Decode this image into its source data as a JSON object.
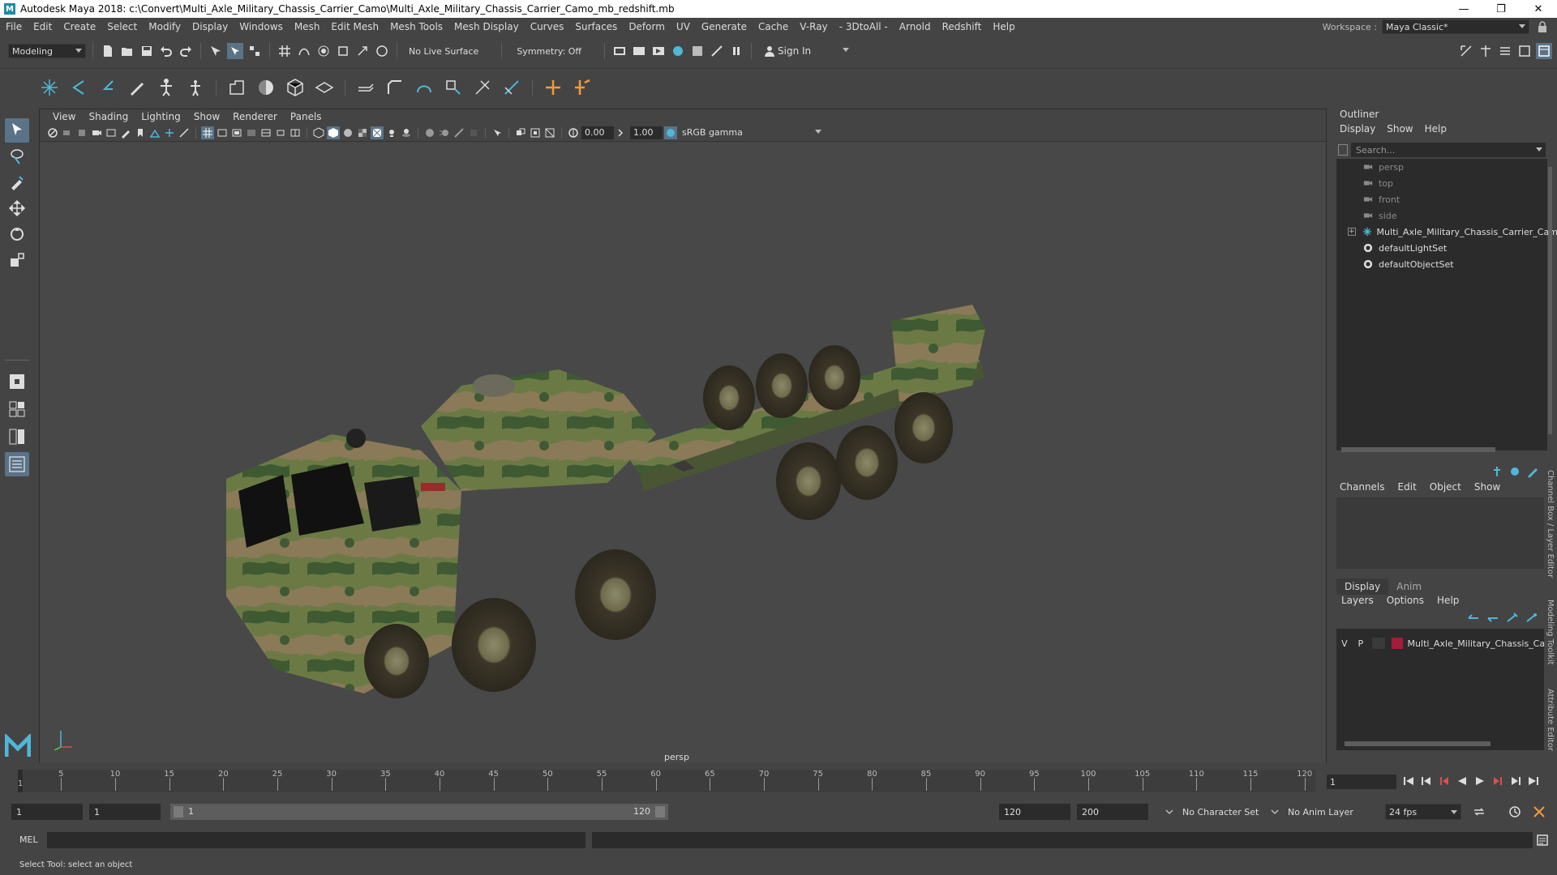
{
  "window": {
    "title": "Autodesk Maya 2018: c:\\Convert\\Multi_Axle_Military_Chassis_Carrier_Camo\\Multi_Axle_Military_Chassis_Carrier_Camo_mb_redshift.mb",
    "logo_letter": "M",
    "minimize": "—",
    "maximize": "❐",
    "close": "✕"
  },
  "menubar": {
    "items": [
      "File",
      "Edit",
      "Create",
      "Select",
      "Modify",
      "Display",
      "Windows",
      "Mesh",
      "Edit Mesh",
      "Mesh Tools",
      "Mesh Display",
      "Curves",
      "Surfaces",
      "Deform",
      "UV",
      "Generate",
      "Cache",
      "V-Ray",
      "- 3DtoAll -",
      "Arnold",
      "Redshift",
      "Help"
    ],
    "workspace_label": "Workspace :",
    "workspace_value": "Maya Classic*"
  },
  "statusline": {
    "mode": "Modeling",
    "live_surface": "No Live Surface",
    "symmetry": "Symmetry: Off",
    "sign_in": "Sign In"
  },
  "viewport": {
    "menus": [
      "View",
      "Shading",
      "Lighting",
      "Show",
      "Renderer",
      "Panels"
    ],
    "exposure": "0.00",
    "gamma": "1.00",
    "color_space": "sRGB gamma",
    "camera_label": "persp"
  },
  "outliner": {
    "title": "Outliner",
    "menus": [
      "Display",
      "Show",
      "Help"
    ],
    "search_placeholder": "Search...",
    "items": [
      {
        "label": "persp",
        "kind": "camera"
      },
      {
        "label": "top",
        "kind": "camera"
      },
      {
        "label": "front",
        "kind": "camera"
      },
      {
        "label": "side",
        "kind": "camera"
      },
      {
        "label": "Multi_Axle_Military_Chassis_Carrier_Cam",
        "kind": "group"
      },
      {
        "label": "defaultLightSet",
        "kind": "set"
      },
      {
        "label": "defaultObjectSet",
        "kind": "set"
      }
    ]
  },
  "channelbox": {
    "menus": [
      "Channels",
      "Edit",
      "Object",
      "Show"
    ]
  },
  "layereditor": {
    "tabs": [
      "Display",
      "Anim"
    ],
    "menus": [
      "Layers",
      "Options",
      "Help"
    ],
    "layer": {
      "v": "V",
      "p": "P",
      "name": "Multi_Axle_Military_Chassis_Ca",
      "color": "#a31c3a"
    }
  },
  "side_tabs": [
    "Channel Box / Layer Editor",
    "Modeling Toolkit",
    "Attribute Editor"
  ],
  "timeslider": {
    "ticks": [
      5,
      10,
      15,
      20,
      25,
      30,
      35,
      40,
      45,
      50,
      55,
      60,
      65,
      70,
      75,
      80,
      85,
      90,
      95,
      100,
      105,
      110,
      115,
      120
    ],
    "current_marker": "1",
    "current_frame": "1"
  },
  "rangeslider": {
    "start_frame": "1",
    "range_start": "1",
    "range_handle_start": "1",
    "range_handle_end": "120",
    "range_end": "120",
    "end_frame": "200",
    "character_set": "No Character Set",
    "anim_layer": "No Anim Layer",
    "fps": "24 fps"
  },
  "cmdline": {
    "language": "MEL"
  },
  "helpline": {
    "text": "Select Tool: select an object"
  }
}
